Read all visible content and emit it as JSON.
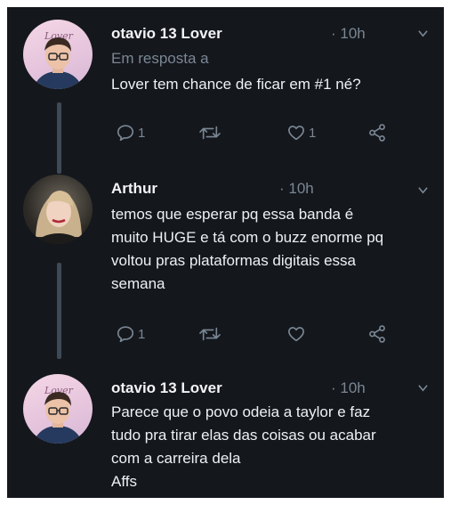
{
  "tweets": [
    {
      "author": "otavio 13 Lover",
      "time": "· 10h",
      "reply_label": "Em resposta a",
      "text": "Lover tem chance de ficar em #1 né?",
      "avatar_text": "Lover",
      "replies": "1",
      "likes": "1"
    },
    {
      "author": "Arthur",
      "time": "· 10h",
      "lines": [
        "temos que esperar pq essa banda é",
        "muito HUGE e tá com o buzz enorme pq",
        "voltou pras plataformas digitais essa",
        "semana"
      ],
      "replies": "1"
    },
    {
      "author": "otavio 13 Lover",
      "time": "· 10h",
      "avatar_text": "Lover",
      "lines": [
        "Parece que o povo odeia a taylor e faz",
        "tudo pra tirar elas das coisas ou acabar",
        "com a carreira dela",
        "Affs"
      ]
    }
  ],
  "icons": {
    "reply": "reply-icon",
    "retweet": "retweet-icon",
    "like": "heart-icon",
    "share": "share-icon",
    "menu": "chevron-down-icon"
  },
  "colors": {
    "background": "#14171c",
    "text": "#eef1f4",
    "secondary": "#7a8794",
    "thread": "#3d4a56"
  }
}
